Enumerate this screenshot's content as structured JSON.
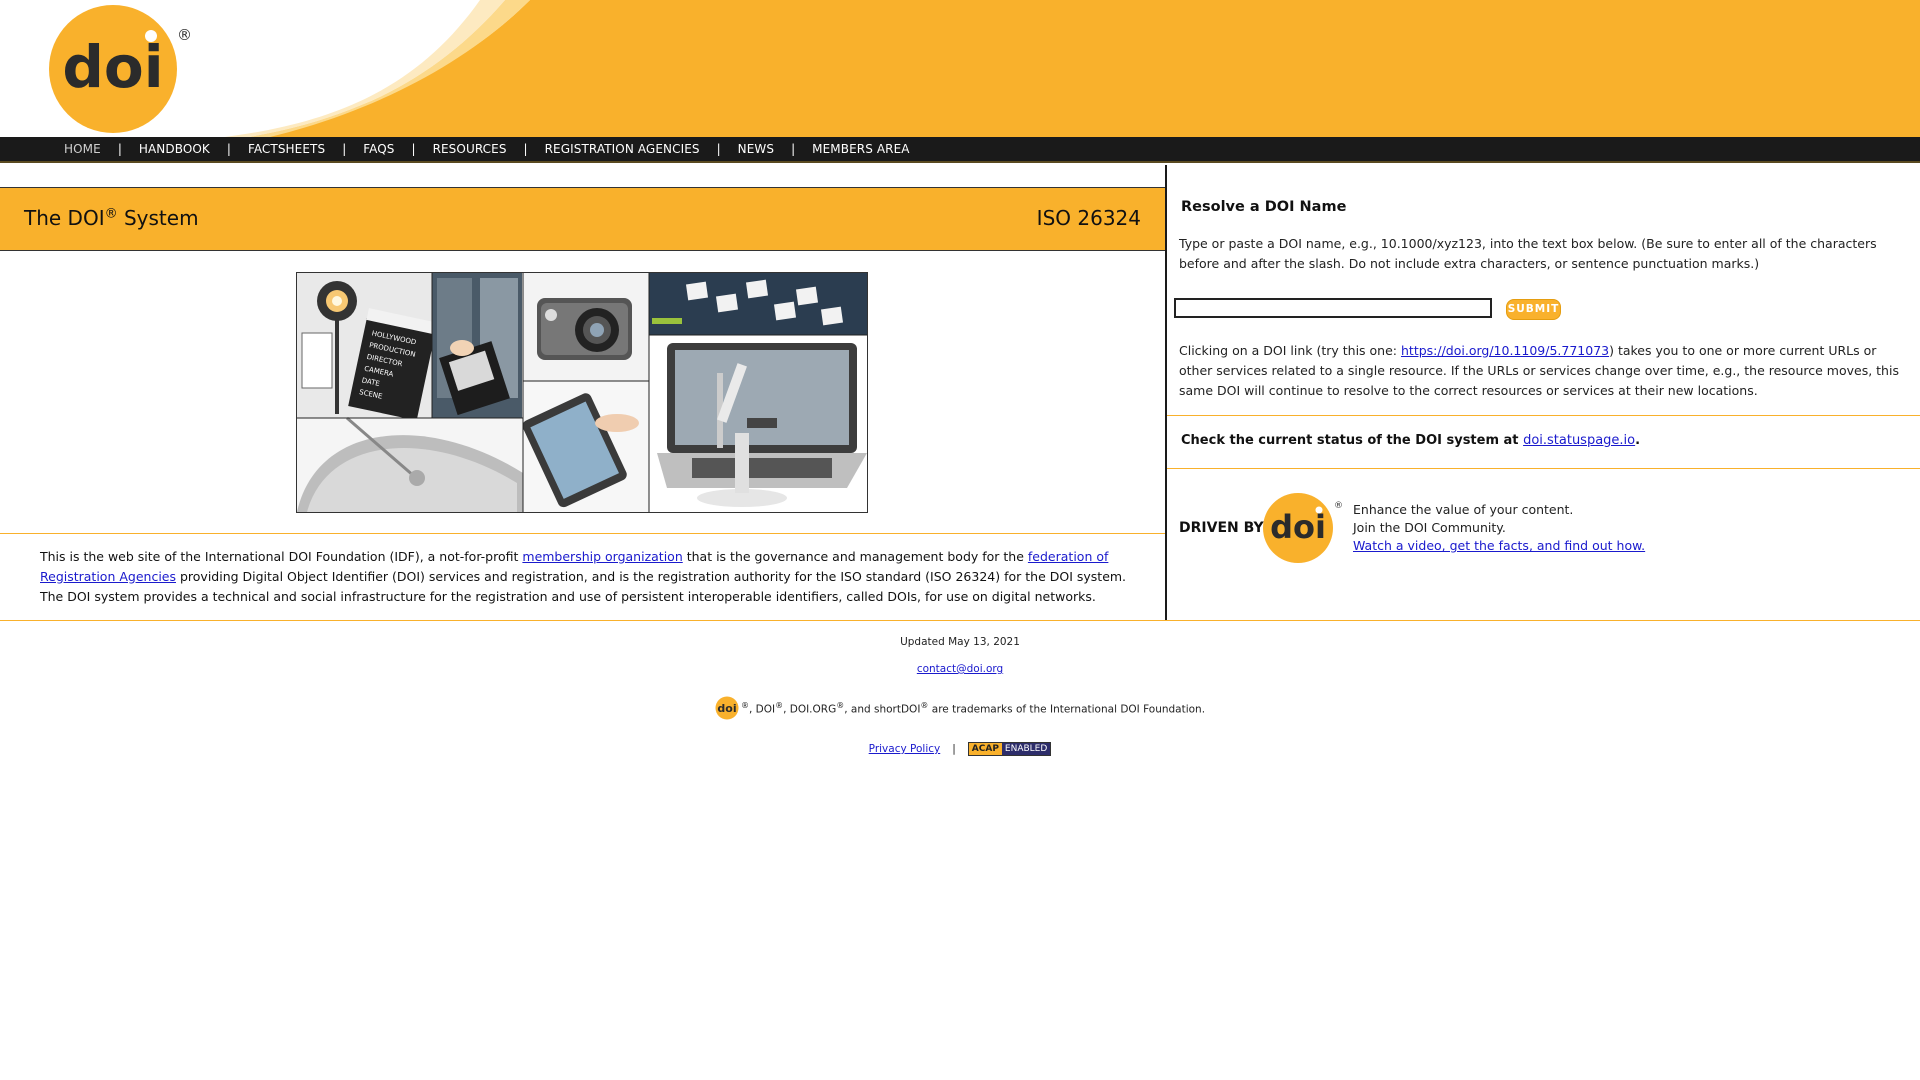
{
  "brand": {
    "logo_text": "doi",
    "registered_mark": "®",
    "accent_color": "#f9b12c",
    "nav_bg_color": "#1a1a1a",
    "link_color": "#1a1acd"
  },
  "nav": {
    "items": [
      {
        "label": "HOME",
        "active": true
      },
      {
        "label": "HANDBOOK"
      },
      {
        "label": "FACTSHEETS"
      },
      {
        "label": "FAQs"
      },
      {
        "label": "RESOURCES"
      },
      {
        "label": "REGISTRATION AGENCIES"
      },
      {
        "label": "NEWS"
      },
      {
        "label": "MEMBERS AREA"
      }
    ],
    "separator": "|"
  },
  "main": {
    "title_prefix": "The DOI",
    "title_sup": "®",
    "title_suffix": " System",
    "iso": "ISO 26324",
    "intro": {
      "part1": "This is the web site of the International DOI Foundation (IDF), a not-for-profit ",
      "link1": "membership organization",
      "part2": " that is the governance and management body for the ",
      "link2": "federation of Registration Agencies",
      "part3": " providing Digital Object Identifier (DOI) services and registration, and is the registration authority for the ISO standard (ISO 26324) for the DOI system. The DOI system provides a technical and social infrastructure for the registration and use of persistent interoperable identifiers, called DOIs, for use on digital networks."
    },
    "collage_clapper_text": [
      "HOLLYWOOD",
      "PRODUCTION",
      "DIRECTOR",
      "CAMERA",
      "DATE",
      "SCENE"
    ]
  },
  "resolver": {
    "title": "Resolve a DOI Name",
    "instructions": "Type or paste a DOI name, e.g., 10.1000/xyz123, into the text box below. (Be sure to enter all of the characters before and after the slash. Do not include extra characters, or sentence punctuation marks.)",
    "input_value": "",
    "submit_label": "SUBMIT",
    "click_part1": "Clicking on a DOI link (try this one: ",
    "click_link": "https://doi.org/10.1109/5.771073",
    "click_part2": ") takes you to one or more current URLs or other services related to a single resource. If the URLs or services change over time, e.g., the resource moves, this same DOI will continue to resolve to the correct resources or services at their new locations."
  },
  "status": {
    "text": "Check the current status of the DOI system at ",
    "link": "doi.statuspage.io",
    "suffix": "."
  },
  "driven": {
    "label": "DRIVEN BY",
    "line1": "Enhance the value of your content.",
    "line2": "Join the DOI Community.",
    "link": "Watch a video, get the facts, and find out how."
  },
  "footer": {
    "updated": "Updated May 13, 2021",
    "contact": "contact@doi.org",
    "tm_part1": ", DOI",
    "tm_part2": ", DOI.ORG",
    "tm_part3": ", and shortDOI",
    "tm_part4": " are trademarks of the International DOI Foundation.",
    "privacy": "Privacy Policy",
    "separator": "|",
    "acap_left": "ACAP",
    "acap_right": "ENABLED"
  }
}
